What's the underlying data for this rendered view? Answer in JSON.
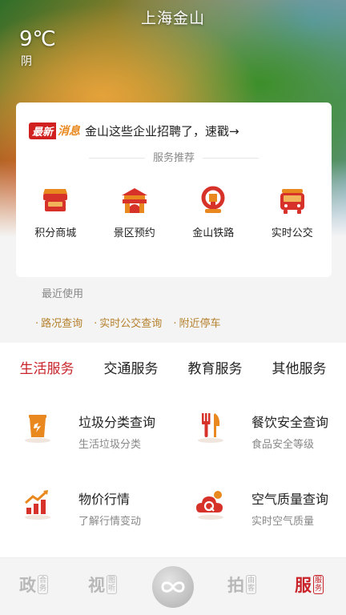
{
  "header": {
    "city": "上海金山",
    "temperature": "9℃",
    "weather": "阴"
  },
  "news": {
    "badge_main": "最新",
    "badge_sub": "消息",
    "text": "金山这些企业招聘了，速戳→"
  },
  "recommend": {
    "title": "服务推荐",
    "items": [
      {
        "label": "积分商城",
        "icon": "shop-icon"
      },
      {
        "label": "景区预约",
        "icon": "scenic-gate-icon"
      },
      {
        "label": "金山铁路",
        "icon": "railway-icon"
      },
      {
        "label": "实时公交",
        "icon": "bus-icon"
      }
    ]
  },
  "recent": {
    "label": "最近使用",
    "items": [
      "路况查询",
      "实时公交查询",
      "附近停车"
    ]
  },
  "categories": {
    "tabs": [
      "生活服务",
      "交通服务",
      "教育服务",
      "其他服务"
    ],
    "active": "生活服务"
  },
  "services": [
    {
      "title": "垃圾分类查询",
      "subtitle": "生活垃圾分类",
      "icon": "trash-bin-icon"
    },
    {
      "title": "餐饮安全查询",
      "subtitle": "食品安全等级",
      "icon": "fork-knife-icon"
    },
    {
      "title": "物价行情",
      "subtitle": "了解行情变动",
      "icon": "price-chart-icon"
    },
    {
      "title": "空气质量查询",
      "subtitle": "实时空气质量",
      "icon": "cloud-q-icon"
    }
  ],
  "bottom_nav": [
    {
      "main": "政",
      "sub": [
        "合",
        "务"
      ]
    },
    {
      "main": "视",
      "sub": [
        "图",
        "听"
      ]
    },
    {
      "main": "拍",
      "sub": [
        "由",
        "客"
      ]
    },
    {
      "main": "服",
      "sub": [
        "服",
        "务"
      ]
    }
  ],
  "colors": {
    "accent": "#c8242a",
    "recent_link": "#b5802c",
    "icon_red": "#d6322a",
    "icon_orange": "#e8881e"
  }
}
